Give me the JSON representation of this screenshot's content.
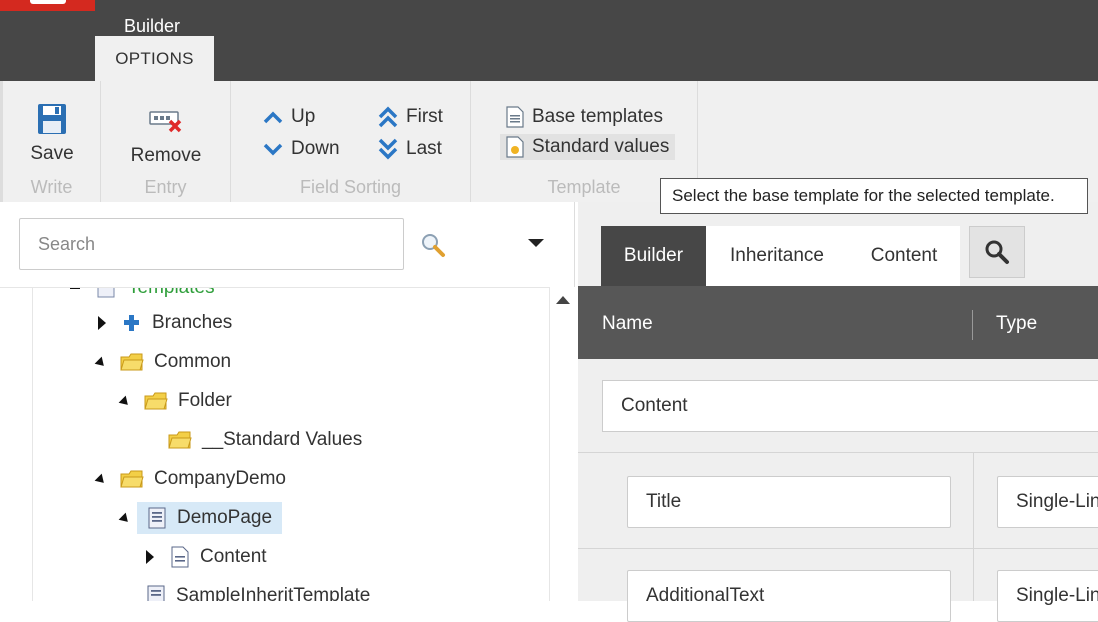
{
  "app": {
    "title": "Builder",
    "ribbon_tab": "OPTIONS",
    "brand_color": "#d4291f"
  },
  "ribbon": {
    "write": {
      "label": "Write",
      "save": "Save"
    },
    "entry": {
      "label": "Entry",
      "remove": "Remove"
    },
    "field_sorting": {
      "label": "Field Sorting",
      "up": "Up",
      "down": "Down",
      "first": "First",
      "last": "Last"
    },
    "template": {
      "label": "Template",
      "base_templates": "Base templates",
      "standard_values": "Standard values"
    }
  },
  "tooltip": "Select the base template for the selected template.",
  "search": {
    "placeholder": "Search"
  },
  "tree": {
    "root": "Templates",
    "items": [
      {
        "label": "Branches",
        "icon": "branches-icon",
        "state": "collapsed"
      },
      {
        "label": "Common",
        "icon": "folder-icon",
        "state": "expanded"
      },
      {
        "label": "Folder",
        "icon": "folder-icon",
        "state": "expanded"
      },
      {
        "label": "__Standard Values",
        "icon": "folder-icon",
        "state": "leaf"
      },
      {
        "label": "CompanyDemo",
        "icon": "folder-icon",
        "state": "expanded"
      },
      {
        "label": "DemoPage",
        "icon": "template-icon",
        "state": "expanded",
        "selected": true
      },
      {
        "label": "Content",
        "icon": "section-icon",
        "state": "collapsed"
      },
      {
        "label": "SampleInheritTemplate",
        "icon": "template-icon",
        "state": "leaf"
      }
    ]
  },
  "editor": {
    "tabs": [
      "Builder",
      "Inheritance",
      "Content"
    ],
    "active_tab": "Builder",
    "columns": {
      "name": "Name",
      "type": "Type"
    },
    "section": "Content",
    "fields": [
      {
        "name": "Title",
        "type": "Single-Lin"
      },
      {
        "name": "AdditionalText",
        "type": "Single-Lin"
      }
    ]
  }
}
